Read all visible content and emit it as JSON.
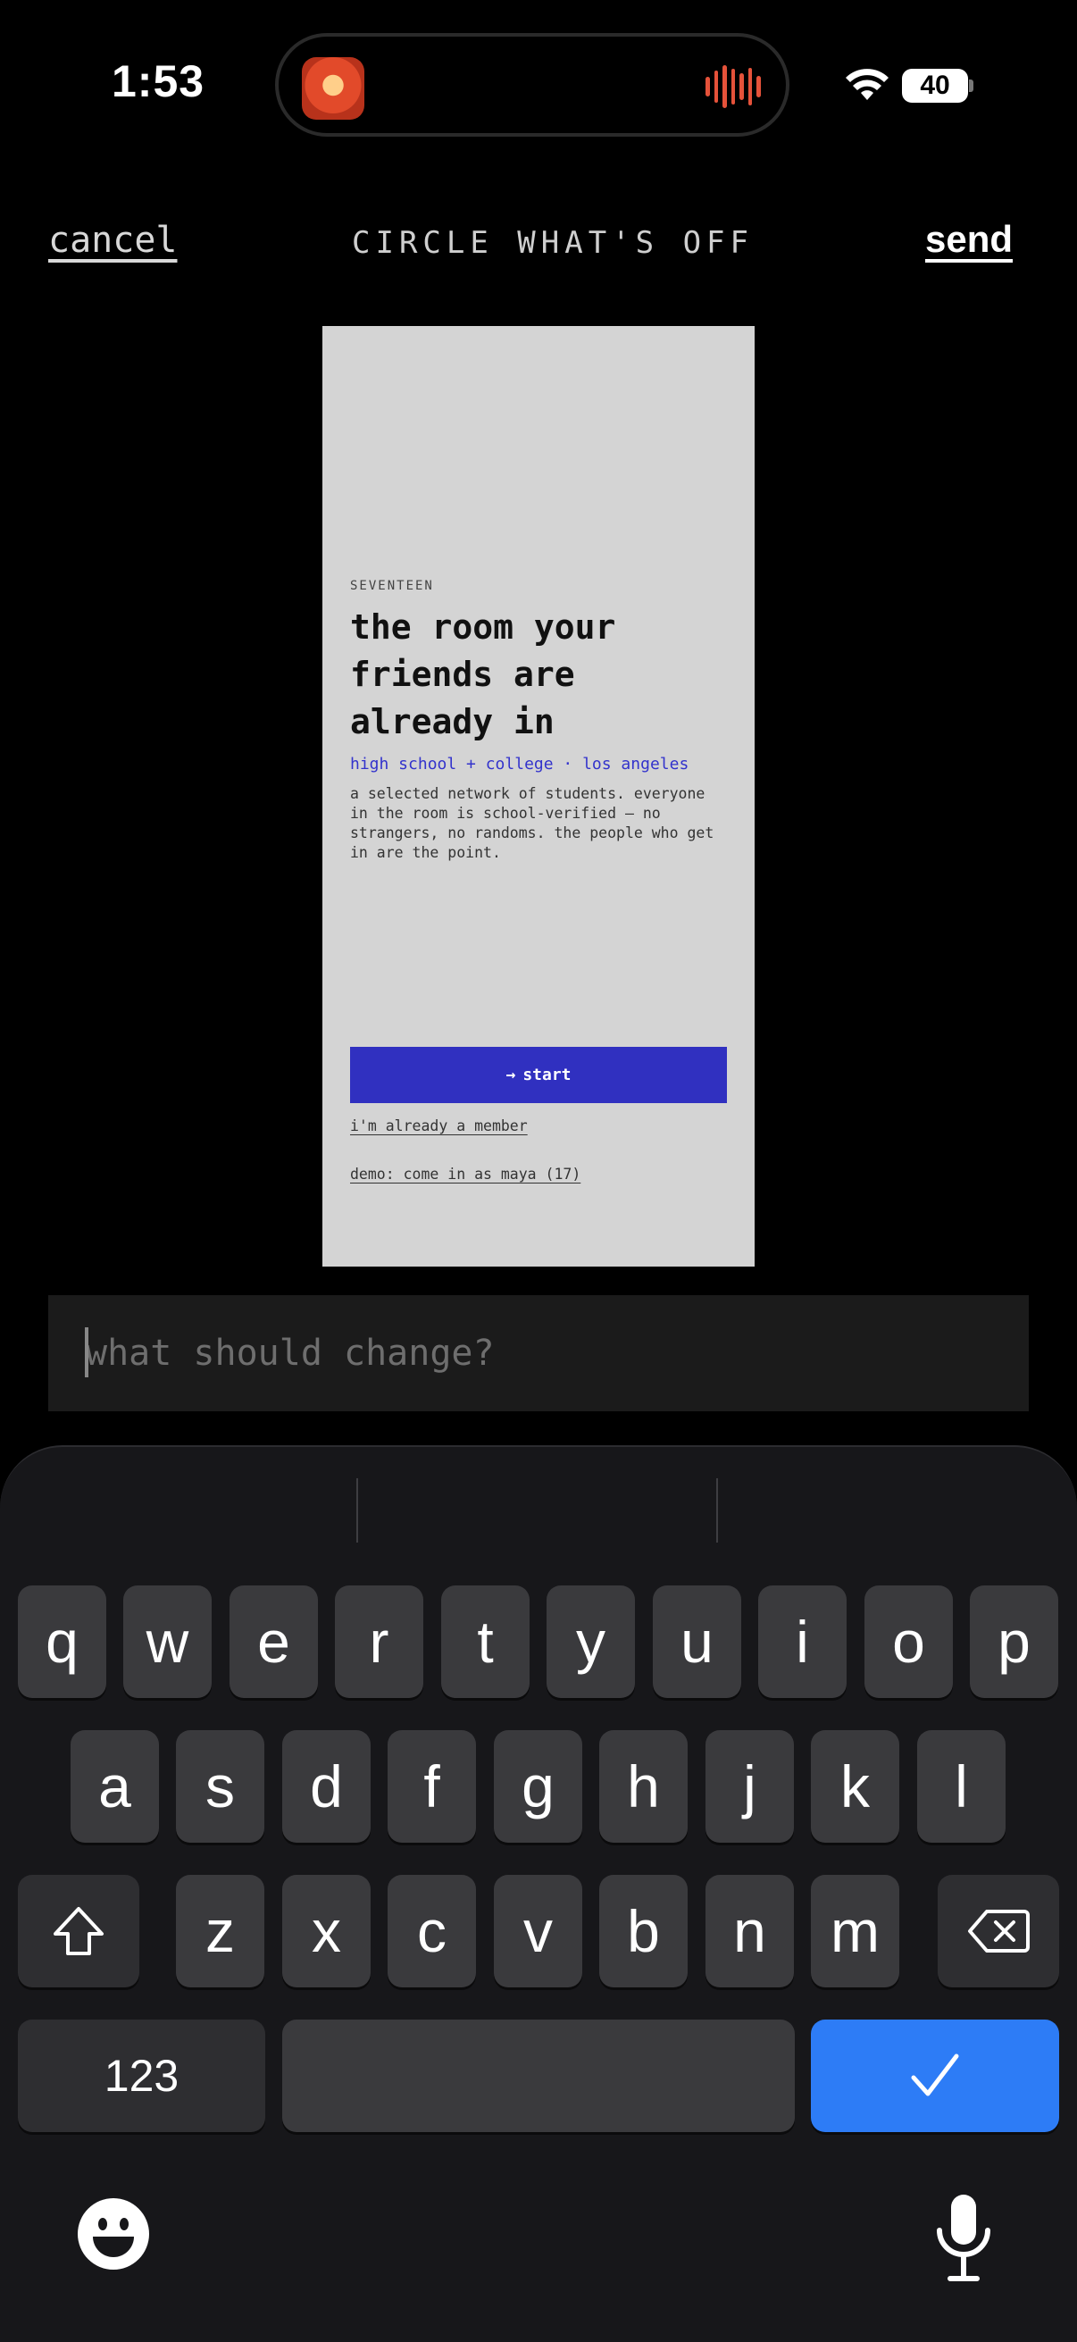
{
  "status_bar": {
    "time": "1:53",
    "battery": "40",
    "icons": [
      "app-thumbnail-icon",
      "audio-waveform-icon",
      "wifi-icon",
      "battery-icon"
    ]
  },
  "header": {
    "cancel": "cancel",
    "title": "CIRCLE WHAT'S OFF",
    "send": "send"
  },
  "preview": {
    "eyebrow": "SEVENTEEN",
    "headline_line1": "the room your",
    "headline_line2": "friends are",
    "headline_line3": "already in",
    "subtitle": "high school + college · los angeles",
    "description_line1": "a selected network of students. everyone",
    "description_line2": "in the room is school-verified — no",
    "description_line3": "strangers, no randoms. the people who get",
    "description_line4": "in are the point.",
    "start_arrow": "→",
    "start_label": "start",
    "member_link": "i'm already a member",
    "demo_link": "demo: come in as maya (17)",
    "colors": {
      "background": "#d4d4d4",
      "accent": "#3030c0"
    }
  },
  "input": {
    "placeholder": "what should change?",
    "value": ""
  },
  "keyboard": {
    "row1": [
      "q",
      "w",
      "e",
      "r",
      "t",
      "y",
      "u",
      "i",
      "o",
      "p"
    ],
    "row2": [
      "a",
      "s",
      "d",
      "f",
      "g",
      "h",
      "j",
      "k",
      "l"
    ],
    "row3": [
      "z",
      "x",
      "c",
      "v",
      "b",
      "n",
      "m"
    ],
    "numbers_key": "123",
    "icons": [
      "shift-icon",
      "delete-icon",
      "checkmark-icon",
      "emoji-icon",
      "microphone-icon"
    ],
    "return_color": "#2d7cf6"
  }
}
